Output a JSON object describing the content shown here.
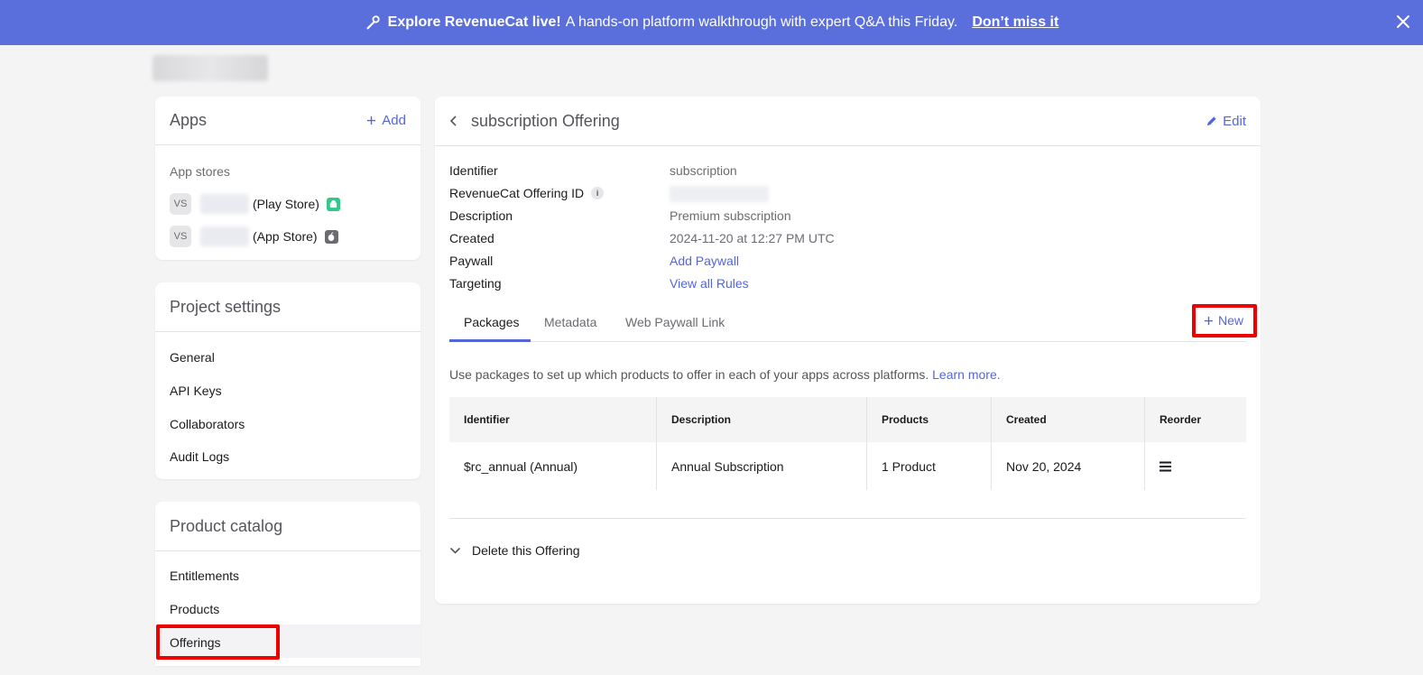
{
  "banner": {
    "headline": "Explore RevenueCat live!",
    "message": "A hands-on platform walkthrough with expert Q&A this Friday.",
    "cta": "Don’t miss it",
    "color": "#5a6fdc"
  },
  "apps": {
    "title": "Apps",
    "add_label": "Add",
    "section_label": "App stores",
    "items": [
      {
        "avatar": "VS",
        "store": "(Play Store)",
        "platform_icon": "android-icon"
      },
      {
        "avatar": "VS",
        "store": "(App Store)",
        "platform_icon": "apple-icon"
      }
    ]
  },
  "project_settings": {
    "title": "Project settings",
    "items": [
      "General",
      "API Keys",
      "Collaborators",
      "Audit Logs"
    ]
  },
  "product_catalog": {
    "title": "Product catalog",
    "items": [
      "Entitlements",
      "Products",
      "Offerings"
    ],
    "active": "Offerings"
  },
  "offering": {
    "title": "subscription Offering",
    "edit_label": "Edit",
    "fields": {
      "identifier_label": "Identifier",
      "identifier_value": "subscription",
      "offering_id_label": "RevenueCat Offering ID",
      "description_label": "Description",
      "description_value": "Premium subscription",
      "created_label": "Created",
      "created_value": "2024-11-20 at 12:27 PM UTC",
      "paywall_label": "Paywall",
      "paywall_value": "Add Paywall",
      "targeting_label": "Targeting",
      "targeting_value": "View all Rules"
    },
    "tabs": [
      "Packages",
      "Metadata",
      "Web Paywall Link"
    ],
    "active_tab": "Packages",
    "new_label": "New",
    "help_text": "Use packages to set up which products to offer in each of your apps across platforms.",
    "help_link": "Learn more.",
    "table": {
      "columns": [
        "Identifier",
        "Description",
        "Products",
        "Created",
        "Reorder"
      ],
      "rows": [
        [
          "$rc_annual (Annual)",
          "Annual Subscription",
          "1 Product",
          "Nov 20, 2024"
        ]
      ]
    },
    "delete_label": "Delete this Offering"
  },
  "colors": {
    "accent": "#5366d8",
    "highlight": "#ee0000"
  }
}
